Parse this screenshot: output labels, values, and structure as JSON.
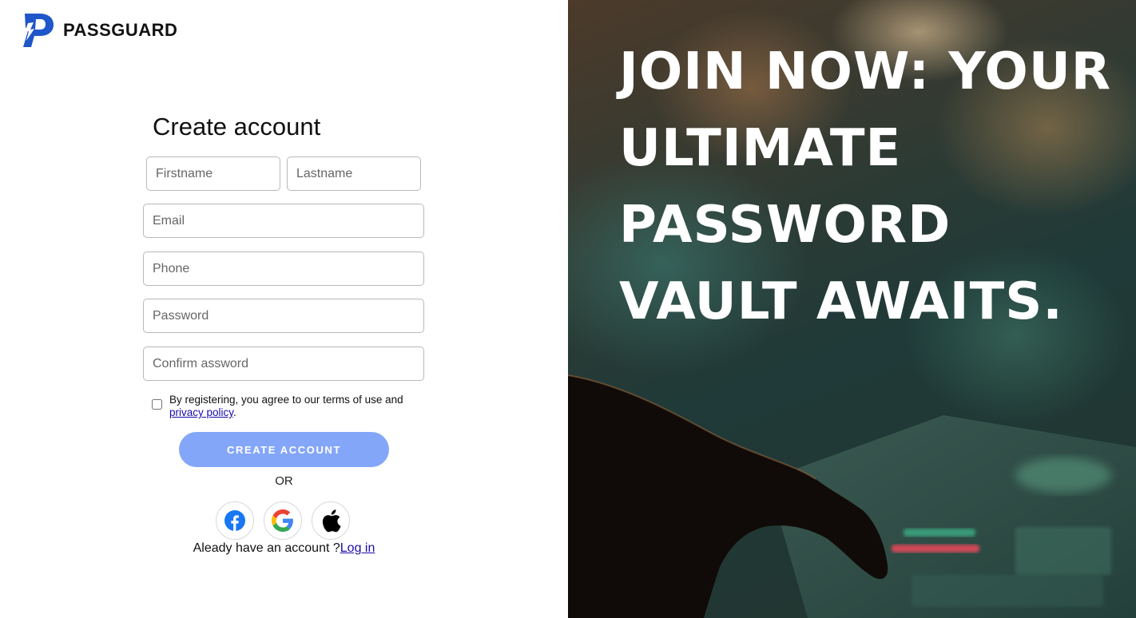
{
  "brand": {
    "name": "PASSGUARD",
    "logo_icon": "passguard-logo-icon"
  },
  "form": {
    "title": "Create account",
    "firstname_placeholder": "Firstname",
    "lastname_placeholder": "Lastname",
    "email_placeholder": "Email",
    "phone_placeholder": "Phone",
    "password_placeholder": "Password",
    "confirm_placeholder": "Confirm assword",
    "terms_text": "By registering, you agree to our terms of use and",
    "privacy_link": "privacy policy",
    "terms_period": ".",
    "submit_label": "CREATE ACCOUNT",
    "or_label": "OR",
    "social_icons": [
      "facebook-icon",
      "google-icon",
      "apple-icon"
    ],
    "login_prompt": "Aleady have an account ?",
    "login_link": "Log in"
  },
  "hero": {
    "headline": "JOIN NOW: YOUR ULTIMATE PASSWORD VAULT AWAITS."
  },
  "colors": {
    "accent": "#84a6f8",
    "logo_blue": "#1f56c9",
    "link": "#1a0dab"
  }
}
